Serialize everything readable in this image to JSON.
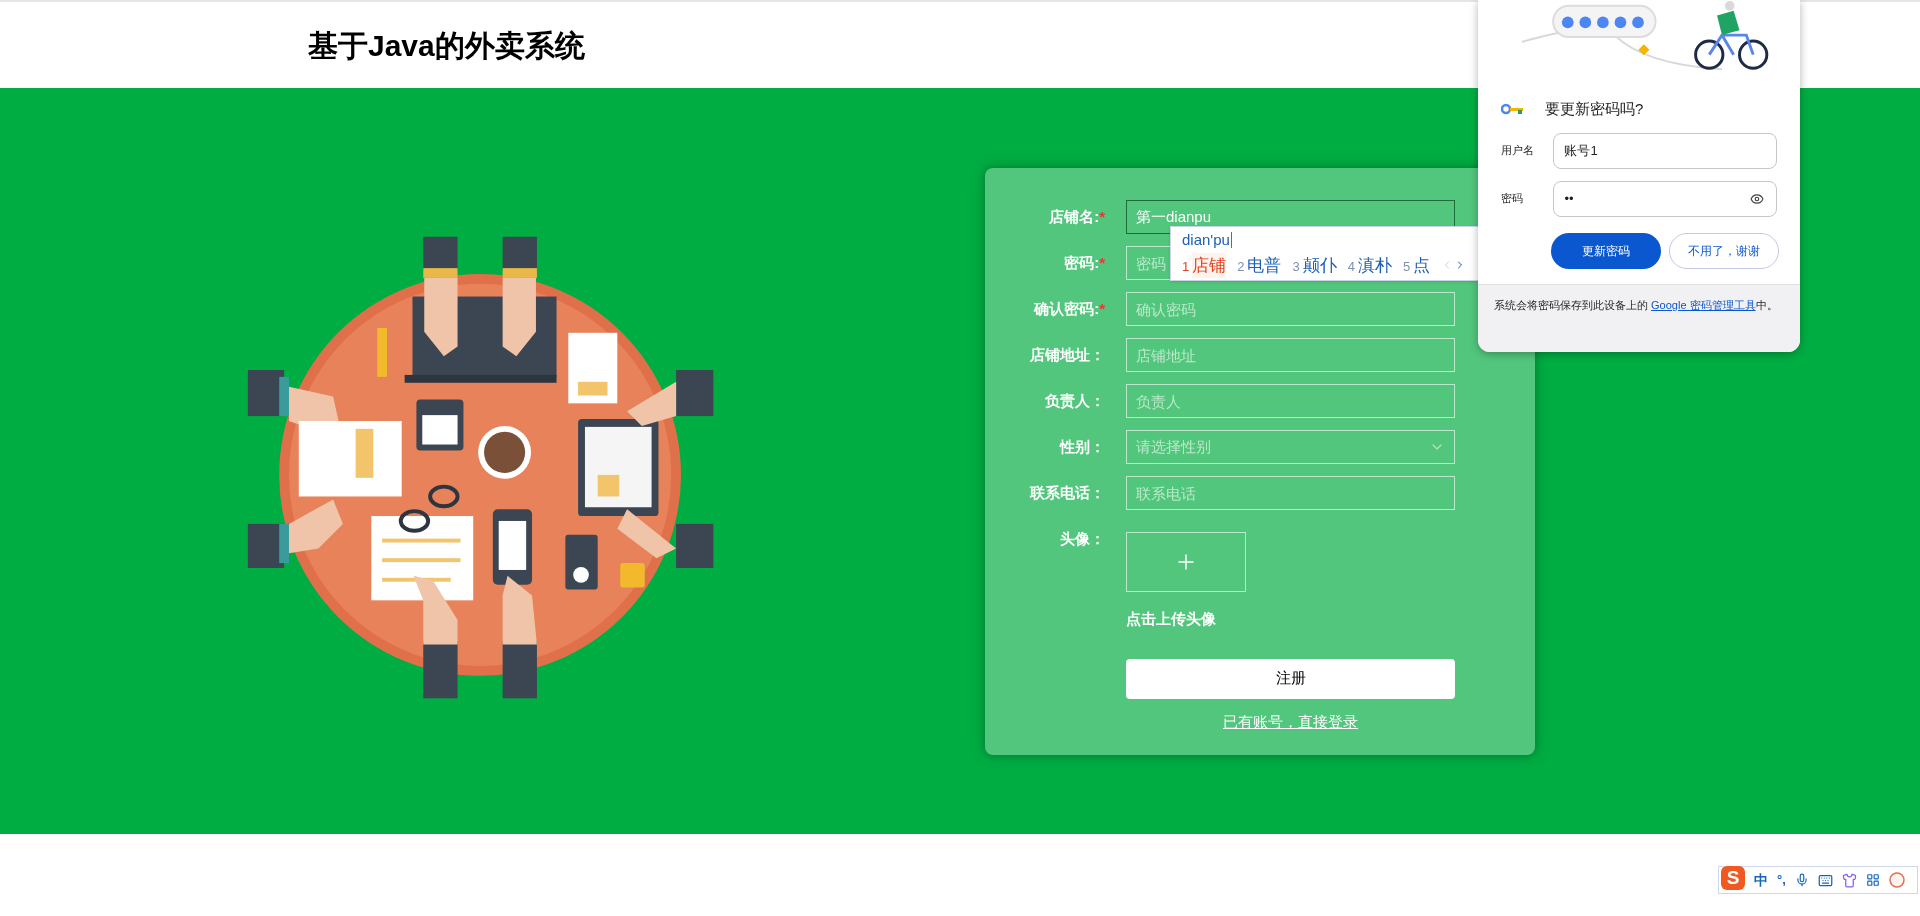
{
  "header": {
    "title": "基于Java的外卖系统"
  },
  "form": {
    "fields": [
      {
        "kind": "text",
        "label": "店铺名:",
        "required_mark": "*",
        "value": "第一dianpu",
        "focused": true
      },
      {
        "kind": "text",
        "label": "密码:",
        "required_mark": "*",
        "placeholder": "密码",
        "focused": false
      },
      {
        "kind": "text",
        "label": "确认密码:",
        "required_mark": "*",
        "placeholder": "确认密码",
        "focused": false
      },
      {
        "kind": "text",
        "label": "店铺地址：",
        "placeholder": "店铺地址",
        "focused": false
      },
      {
        "kind": "text",
        "label": "负责人：",
        "placeholder": "负责人",
        "focused": false
      },
      {
        "kind": "select",
        "label": "性别：",
        "placeholder": "请选择性别",
        "focused": false
      },
      {
        "kind": "text",
        "label": "联系电话：",
        "placeholder": "联系电话",
        "focused": false
      },
      {
        "kind": "upload",
        "label": "头像：",
        "caption": "点击上传头像"
      }
    ],
    "submit": "注册",
    "login_link": "已有账号，直接登录"
  },
  "ime_popup": {
    "composition": "dian'pu",
    "candidates": [
      {
        "index": "1",
        "text": "店铺",
        "selected": true
      },
      {
        "index": "2",
        "text": "电普",
        "selected": false
      },
      {
        "index": "3",
        "text": "颠仆",
        "selected": false
      },
      {
        "index": "4",
        "text": "滇朴",
        "selected": false
      },
      {
        "index": "5",
        "text": "点",
        "selected": false
      }
    ]
  },
  "password_prompt": {
    "title": "要更新密码吗?",
    "username_label": "用户名",
    "username": "账号1",
    "password_label": "密码",
    "password": "••",
    "primary": "更新密码",
    "secondary": "不用了，谢谢",
    "footer": "系统会将密码保存到此设备上的 ",
    "footer_link": "Google 密码管理工具",
    "footer_end": "中。"
  },
  "ime_toolbar": {
    "logo": "S",
    "mode": "中",
    "punctuation": "°,"
  }
}
